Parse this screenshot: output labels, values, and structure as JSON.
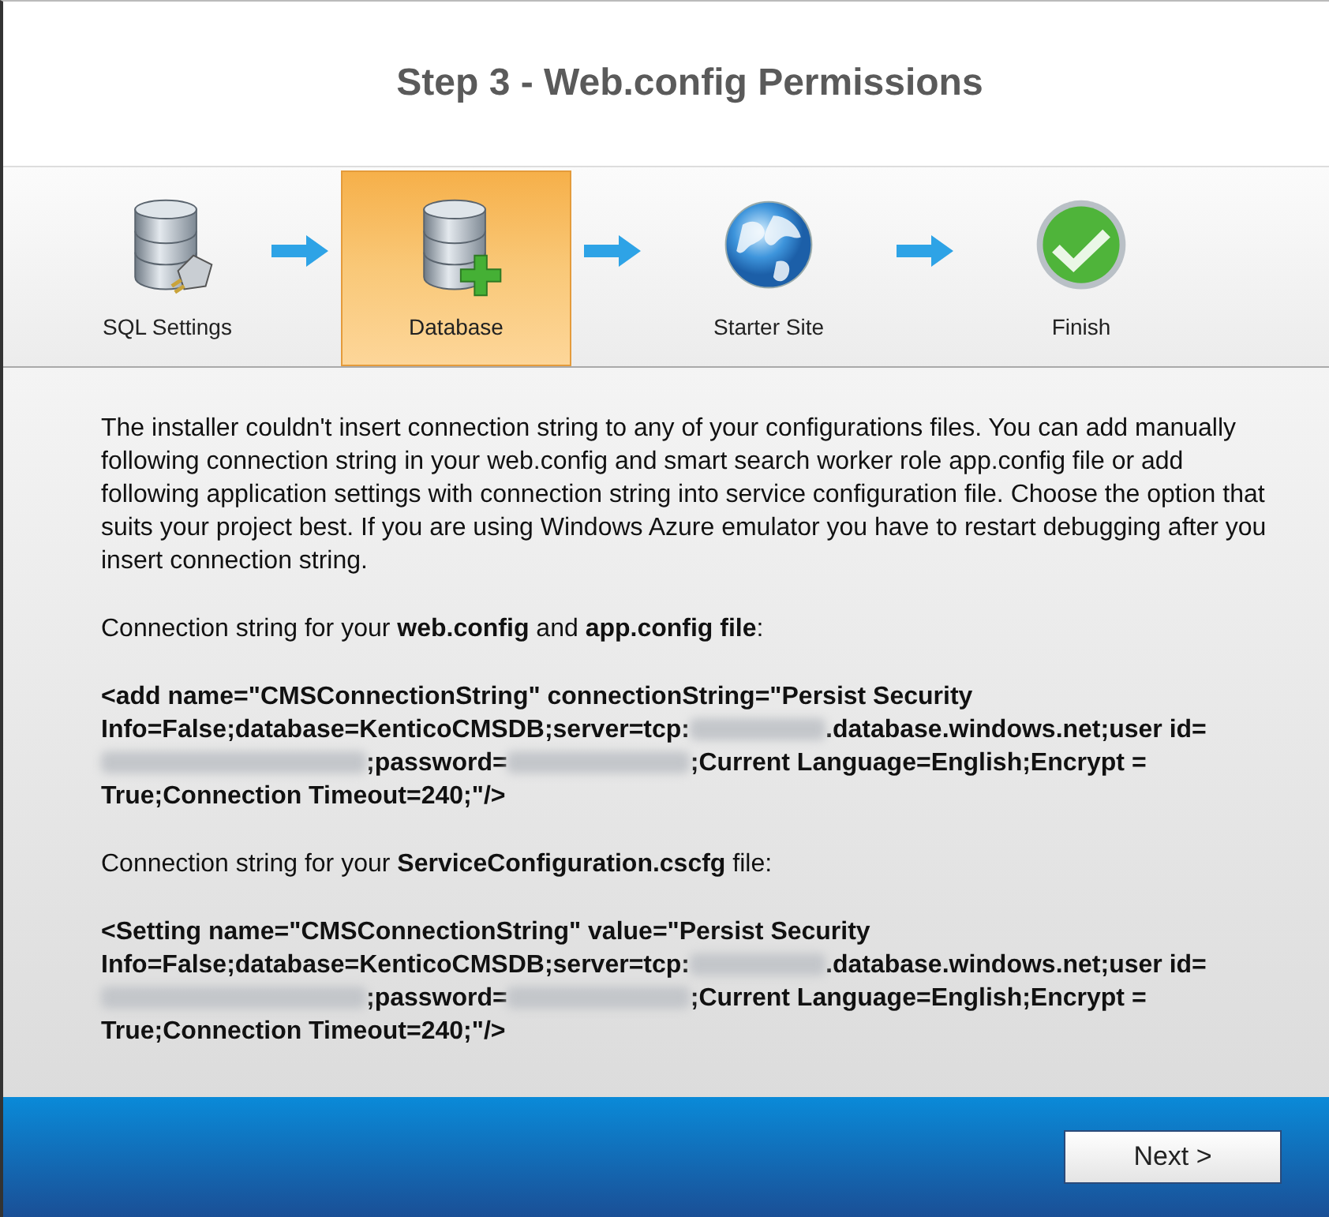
{
  "title": "Step 3 - Web.config Permissions",
  "steps": [
    {
      "label": "SQL Settings",
      "kind": "sql",
      "selected": false
    },
    {
      "label": "Database",
      "kind": "database",
      "selected": true
    },
    {
      "label": "Starter Site",
      "kind": "globe",
      "selected": false
    },
    {
      "label": "Finish",
      "kind": "finish",
      "selected": false
    }
  ],
  "intro": "The installer couldn't insert connection string to any of your configurations files. You can add manually following connection string in your web.config and smart search worker role app.config file or add following application settings with connection string into service configuration file. Choose the option that suits your project best. If you are using Windows Azure emulator you have to restart debugging after you insert connection string.",
  "sections": [
    {
      "heading": "Connection string for your **web.config** and **app.config file**:",
      "code": [
        {
          "kind": "text",
          "text": "<add name=\"CMSConnectionString\" connectionString=\"Persist Security Info=False;database=KenticoCMSDB;server=tcp:"
        },
        {
          "kind": "redacted"
        },
        {
          "kind": "text",
          "text": ".database.windows.net;user id="
        },
        {
          "kind": "redacted"
        },
        {
          "kind": "text",
          "text": ";password="
        },
        {
          "kind": "redacted"
        },
        {
          "kind": "text",
          "text": ";Current Language=English;Encrypt = True;Connection Timeout=240;\"/>"
        }
      ]
    },
    {
      "heading": "Connection string for your **ServiceConfiguration.cscfg** file:",
      "code": [
        {
          "kind": "text",
          "text": "<Setting name=\"CMSConnectionString\" value=\"Persist Security Info=False;database=KenticoCMSDB;server=tcp:"
        },
        {
          "kind": "redacted"
        },
        {
          "kind": "text",
          "text": ".database.windows.net;user id="
        },
        {
          "kind": "redacted"
        },
        {
          "kind": "text",
          "text": ";password="
        },
        {
          "kind": "redacted"
        },
        {
          "kind": "text",
          "text": ";Current Language=English;Encrypt = True;Connection Timeout=240;\"/>"
        }
      ]
    }
  ],
  "next_button": "Next >"
}
